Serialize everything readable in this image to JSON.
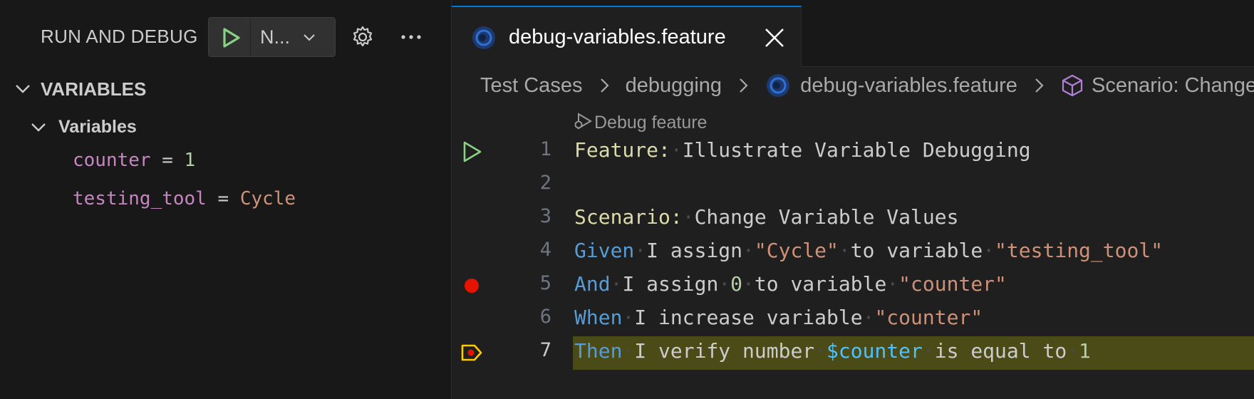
{
  "sidebar": {
    "title": "RUN AND DEBUG",
    "config_label": "N...",
    "section_title": "VARIABLES",
    "scope_title": "Variables",
    "variables": [
      {
        "name": "counter",
        "eq": " = ",
        "value": "1",
        "kind": "number"
      },
      {
        "name": "testing_tool",
        "eq": " = ",
        "value": "Cycle",
        "kind": "string"
      }
    ]
  },
  "editor": {
    "tab_label": "debug-variables.feature",
    "breadcrumbs": [
      "Test Cases",
      "debugging",
      "debug-variables.feature",
      "Scenario: Change Variable Values"
    ],
    "codelens": "Debug feature",
    "current_line": 7,
    "breakpoint_line": 5,
    "lines": [
      {
        "number": "1",
        "glyph": "run"
      },
      {
        "number": "2",
        "glyph": "none"
      },
      {
        "number": "3",
        "glyph": "none"
      },
      {
        "number": "4",
        "glyph": "none"
      },
      {
        "number": "5",
        "glyph": "breakpoint"
      },
      {
        "number": "6",
        "glyph": "none"
      },
      {
        "number": "7",
        "glyph": "current-breakpoint"
      }
    ],
    "code": {
      "l1_keyword": "Feature:",
      "l1_text": "Illustrate Variable Debugging",
      "l3_keyword": "Scenario:",
      "l3_text": "Change Variable Values",
      "l4_keyword": "Given",
      "l4_a": "I assign",
      "l4_s1": "\"Cycle\"",
      "l4_b": "to variable",
      "l4_s2": "\"testing_tool\"",
      "l5_keyword": "And",
      "l5_a": "I assign",
      "l5_n": "0",
      "l5_b": "to variable",
      "l5_s": "\"counter\"",
      "l6_keyword": "When",
      "l6_a": "I increase variable",
      "l6_s": "\"counter\"",
      "l7_keyword": "Then",
      "l7_a": "I verify number",
      "l7_var": "$counter",
      "l7_b": "is equal to",
      "l7_n": "1"
    }
  },
  "colors": {
    "background": "#181818",
    "editor_background": "#1f1f1f",
    "current_line_highlight": "#4b4b18",
    "run_green": "#89d185",
    "breakpoint_red": "#e51400",
    "debug_yellow": "#ffcc00",
    "tab_accent": "#0078d4",
    "keyword_blue": "#569cd6",
    "feature_yellow": "#dcdcaa",
    "string_orange": "#ce9178",
    "number_green": "#b5cea8",
    "variable_purple": "#c586c0"
  },
  "icons": [
    "play-icon",
    "chevron-down-icon",
    "gear-icon",
    "more-icon",
    "chevron-right-icon",
    "close-icon",
    "feature-file-icon",
    "cube-icon",
    "debug-icon",
    "breakpoint-icon",
    "current-line-icon"
  ]
}
